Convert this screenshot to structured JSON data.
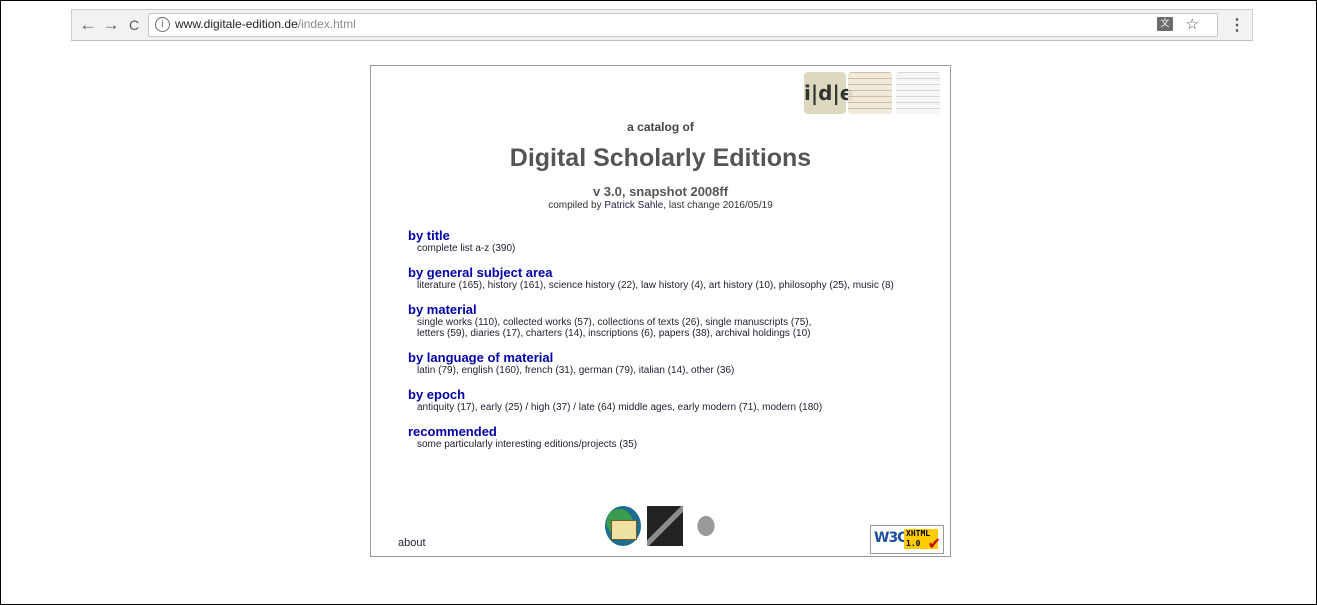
{
  "browser": {
    "back_glyph": "←",
    "forward_glyph": "→",
    "reload_glyph": "C",
    "info_glyph": "i",
    "url_domain": "www.digitale-edition.de",
    "url_path": "/index.html",
    "translate_glyph": "文",
    "star_glyph": "☆",
    "menu_glyph": "⋮"
  },
  "header": {
    "logo_idle": "i|d|e",
    "catalog_of": "a catalog of",
    "title": "Digital Scholarly Editions",
    "version": "v 3.0, snapshot 2008ff",
    "compiled_prefix": "compiled by ",
    "author": "Patrick Sahle",
    "compiled_suffix": ", last change 2016/05/19"
  },
  "sections": [
    {
      "title": "by title",
      "lines": [
        "complete list a-z (390)"
      ]
    },
    {
      "title": "by general subject area",
      "lines": [
        "literature (165), history (161), science history (22), law history (4), art history (10), philosophy (25), music (8)"
      ]
    },
    {
      "title": "by material",
      "lines": [
        "single works (110), collected works (57), collections of texts (26), single manuscripts (75),",
        "letters (59), diaries (17), charters (14), inscriptions (6), papers (38), archival holdings (10)"
      ]
    },
    {
      "title": "by language of material",
      "lines": [
        "latin (79), english (160), french (31), german (79), italian (14), other (36)"
      ]
    },
    {
      "title": "by epoch",
      "lines": [
        "antiquity (17), early (25) / high (37) / late (64) middle ages, early modern (71), modern (180)"
      ]
    },
    {
      "title": "recommended",
      "lines": [
        "some particularly interesting editions/projects (35)"
      ]
    }
  ],
  "footer": {
    "about": "about",
    "w3c": "W3C",
    "xhtml": "XHTML 1.0",
    "check": "✔"
  }
}
